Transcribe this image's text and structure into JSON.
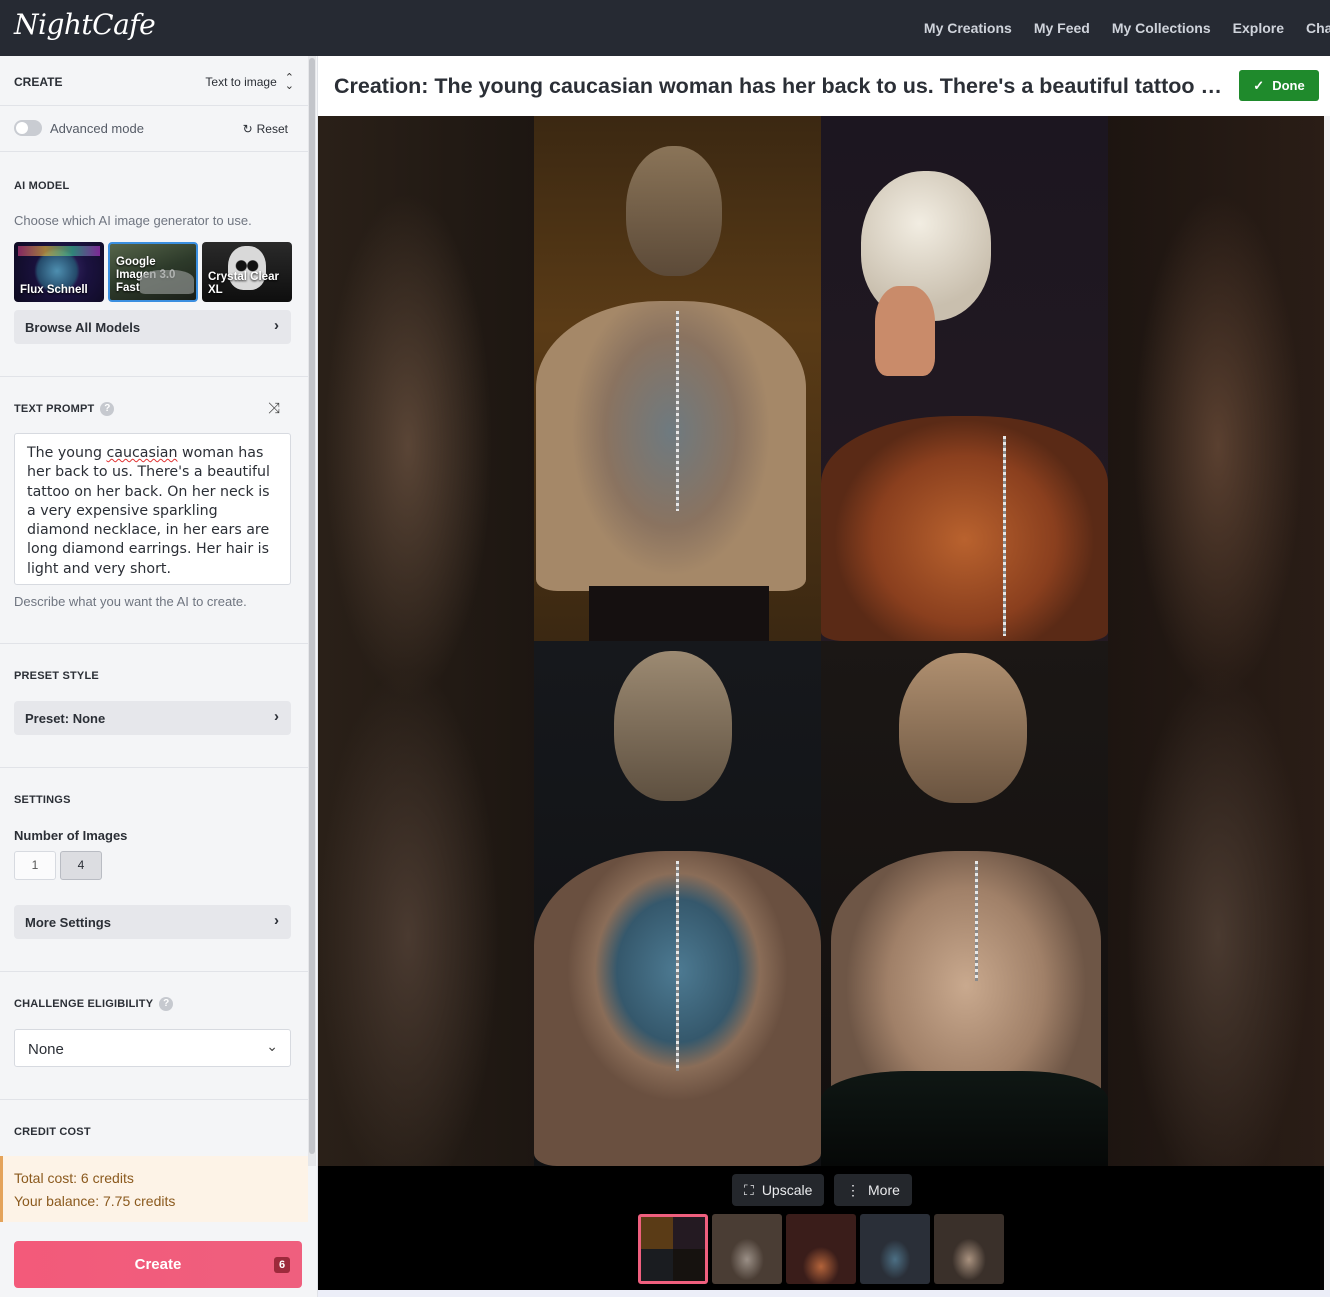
{
  "app": {
    "logo": "NightCafe"
  },
  "nav": {
    "items": [
      "My Creations",
      "My Feed",
      "My Collections",
      "Explore",
      "Cha"
    ]
  },
  "sidebar": {
    "create_label": "CREATE",
    "mode": "Text to image",
    "advanced_mode": "Advanced mode",
    "reset": "Reset",
    "ai_model": {
      "title": "AI MODEL",
      "description": "Choose which AI image generator to use.",
      "models": [
        "Flux Schnell",
        "Google Imagen 3.0 Fast",
        "Crystal Clear XL"
      ],
      "browse_label": "Browse All Models"
    },
    "text_prompt": {
      "title": "TEXT PROMPT",
      "help": "?",
      "prompt_before": "The young ",
      "prompt_misspelled": "caucasian",
      "prompt_after": " woman has her back to us. There's a beautiful tattoo on her back. On her neck is a very expensive sparkling diamond necklace, in her ears are long diamond earrings. Her hair is light and very short.",
      "hint": "Describe what you want the AI to create."
    },
    "preset_style": {
      "title": "PRESET STYLE",
      "button_label": "Preset: None"
    },
    "settings": {
      "title": "SETTINGS",
      "num_images_label": "Number of Images",
      "options": [
        "1",
        "4"
      ],
      "selected": "4",
      "more_settings_label": "More Settings"
    },
    "challenge": {
      "title": "CHALLENGE ELIGIBILITY",
      "help": "?",
      "value": "None"
    },
    "credit": {
      "title": "CREDIT COST",
      "total": "Total cost: 6 credits",
      "balance": "Your balance: 7.75 credits"
    },
    "create_button": {
      "label": "Create",
      "badge": "6"
    }
  },
  "main": {
    "title": "Creation: The young caucasian woman has her back to us. There's a beautiful tattoo on her back. On her neck is a very expensive sparkling diamond necklace",
    "done_label": "Done",
    "toolbar": {
      "upscale_label": "Upscale",
      "more_label": "More"
    },
    "thumbnail_count": 5,
    "selected_thumbnail": 1
  },
  "colors": {
    "topbar": "#262a33",
    "create_accent": "#ef5f7e",
    "done_green": "#1f8a2c",
    "credit_text": "#8b5a1e"
  }
}
